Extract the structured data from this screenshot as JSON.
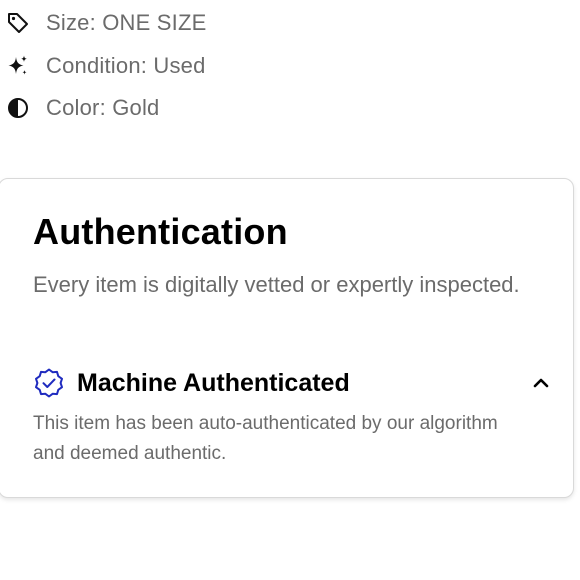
{
  "attributes": [
    {
      "icon": "tag-icon",
      "label": "Size: ONE SIZE"
    },
    {
      "icon": "sparkle-icon",
      "label": "Condition: Used"
    },
    {
      "icon": "half-circle-icon",
      "label": "Color: Gold"
    }
  ],
  "authentication": {
    "title": "Authentication",
    "description": "Every item is digitally vetted or expertly inspected.",
    "method": {
      "icon": "verified-badge-icon",
      "title": "Machine Authenticated",
      "description": "This item has been auto-authenticated by our algorithm and deemed authentic.",
      "expanded": true,
      "chevron_icon": "chevron-up-icon"
    }
  },
  "colors": {
    "badge": "#1f2bbf",
    "muted_text": "#6b6b6b",
    "heading_text": "#000000"
  }
}
